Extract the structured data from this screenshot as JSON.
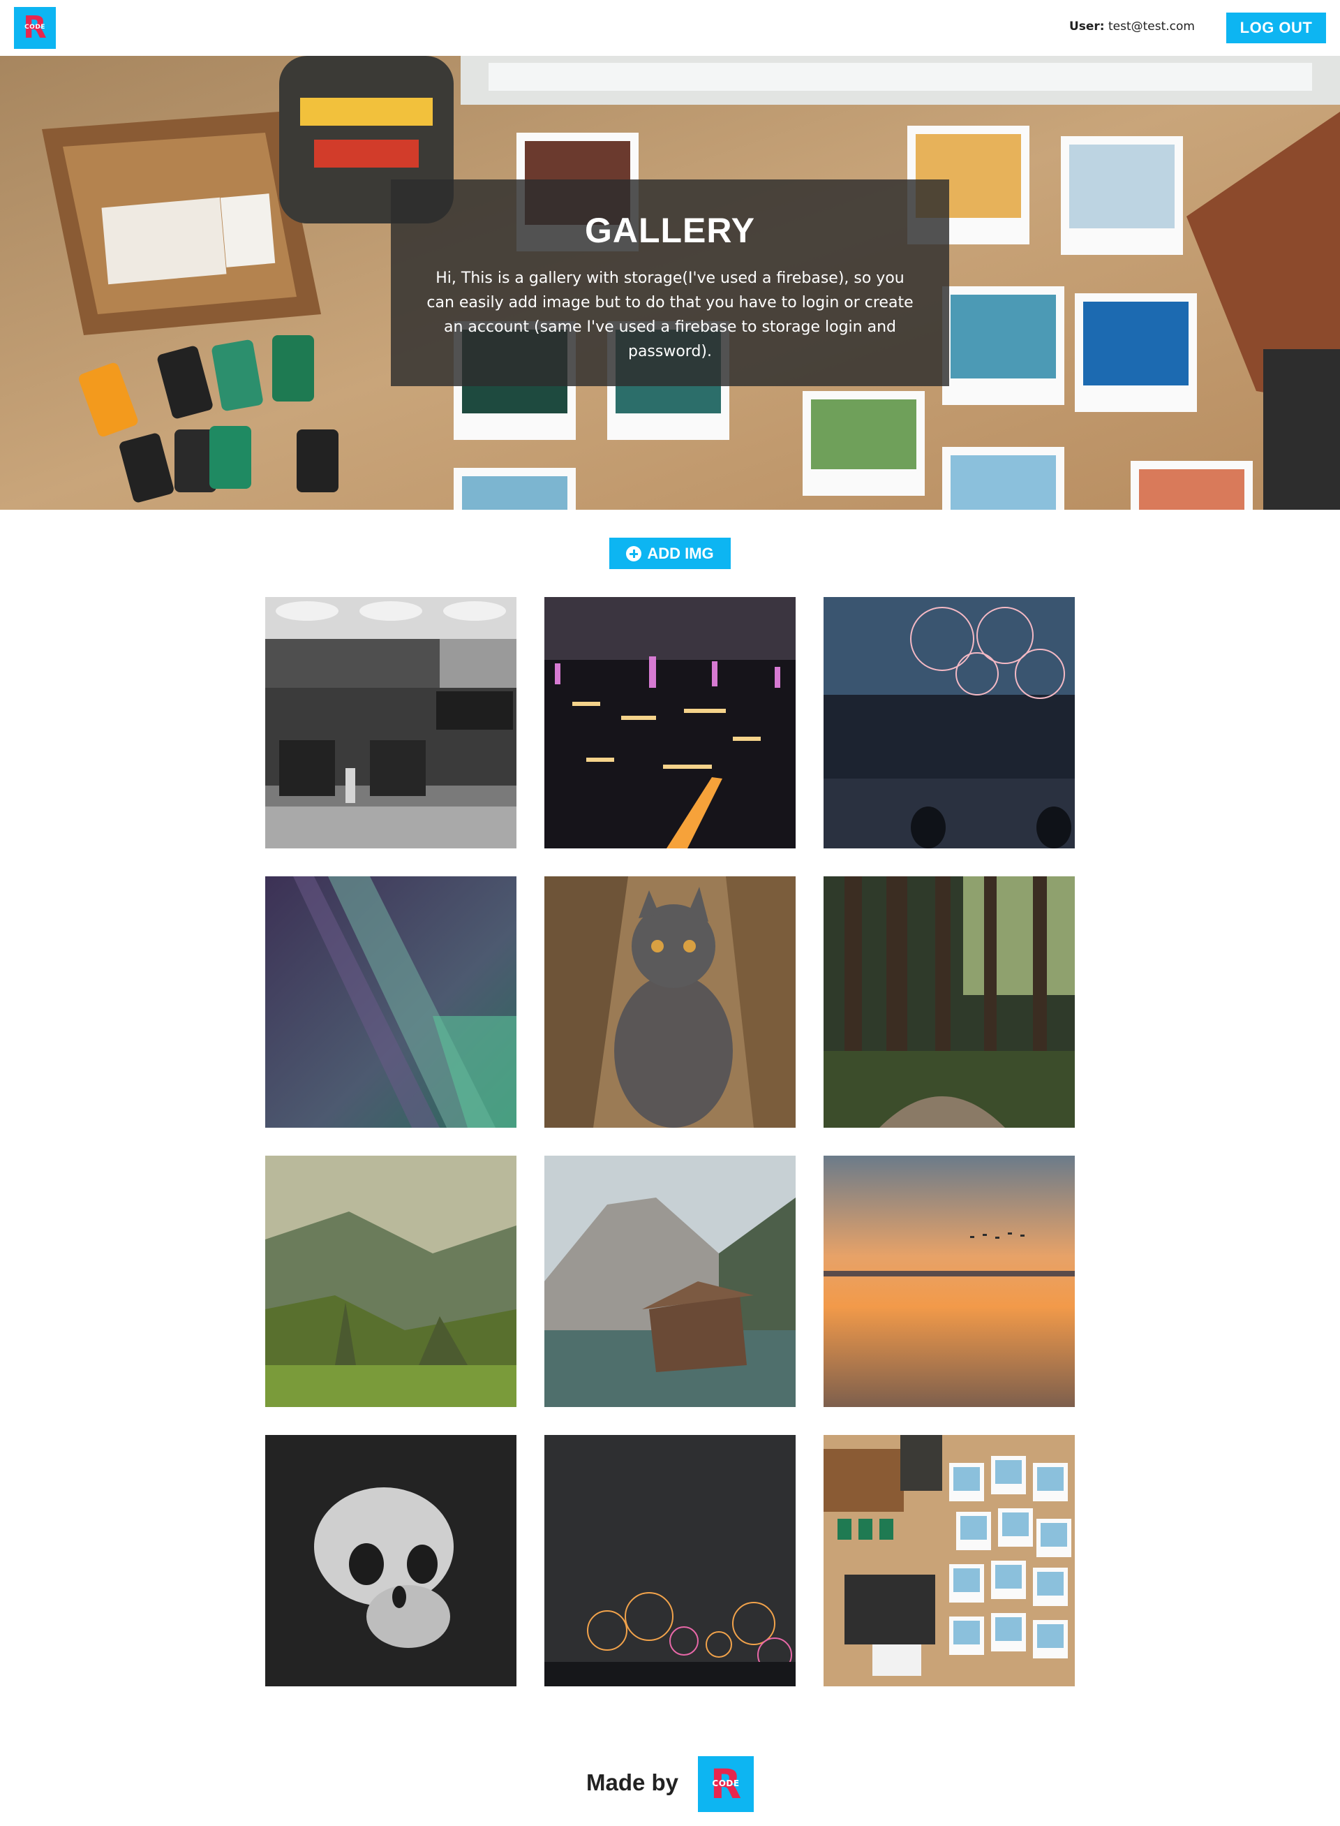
{
  "header": {
    "logo": {
      "text": "CODE",
      "letter": "R",
      "icon": "r-code-logo"
    },
    "user_label": "User:",
    "user_email": "test@test.com",
    "logout_label": "LOG OUT"
  },
  "hero": {
    "title": "GALLERY",
    "description": "Hi, This is a gallery with storage(I've used a firebase), so you can easily add image but to do that you have to login or create an account (same I've used a firebase to storage login and password)."
  },
  "add_button": {
    "label": "ADD IMG",
    "icon": "plus-circle-icon"
  },
  "gallery": {
    "photos": [
      {
        "subject": "theatre-street"
      },
      {
        "subject": "city-night"
      },
      {
        "subject": "fireworks-lake"
      },
      {
        "subject": "aurora"
      },
      {
        "subject": "cat"
      },
      {
        "subject": "forest"
      },
      {
        "subject": "mountains"
      },
      {
        "subject": "lake-cabin"
      },
      {
        "subject": "sunset-beach"
      },
      {
        "subject": "skull"
      },
      {
        "subject": "fireworks-city"
      },
      {
        "subject": "polaroids-table"
      }
    ]
  },
  "footer": {
    "made_by": "Made by",
    "logo_text": "CODE",
    "logo_letter": "R"
  },
  "colors": {
    "accent": "#0db5f2",
    "logo_red": "#e8264e",
    "panel": "#2d2d2d"
  }
}
